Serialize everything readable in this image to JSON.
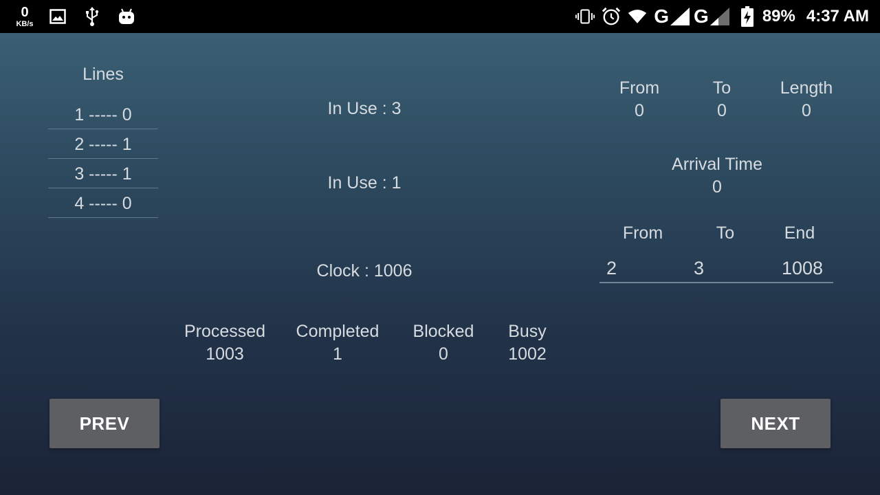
{
  "status_bar": {
    "speed_value": "0",
    "speed_unit": "KB/s",
    "left_icons": [
      "image-icon",
      "usb-icon",
      "android-icon"
    ],
    "right_icons": [
      "vibrate-icon",
      "alarm-icon",
      "wifi-icon",
      "signal-icon"
    ],
    "network_1": "G",
    "network_2": "G",
    "battery_pct": "89%",
    "time": "4:37 AM"
  },
  "lines": {
    "title": "Lines",
    "rows": [
      "1 ----- 0",
      "2 ----- 1",
      "3 ----- 1",
      "4 ----- 0"
    ]
  },
  "center": {
    "in_use_1": "In Use : 3",
    "in_use_2": "In Use : 1",
    "clock": "Clock : 1006"
  },
  "stats": {
    "processed_label": "Processed",
    "processed_value": "1003",
    "completed_label": "Completed",
    "completed_value": "1",
    "blocked_label": "Blocked",
    "blocked_value": "0",
    "busy_label": "Busy",
    "busy_value": "1002"
  },
  "call": {
    "from_label": "From",
    "from_value": "0",
    "to_label": "To",
    "to_value": "0",
    "length_label": "Length",
    "length_value": "0",
    "arrival_label": "Arrival Time",
    "arrival_value": "0"
  },
  "active": {
    "from_label": "From",
    "to_label": "To",
    "end_label": "End",
    "from_value": "2",
    "to_value": "3",
    "end_value": "1008"
  },
  "buttons": {
    "prev": "PREV",
    "next": "NEXT"
  },
  "colors": {
    "background_top": "#3e6479",
    "background_bottom": "#1b2336",
    "button": "#5d5f62",
    "text": "#d6dbe0"
  }
}
